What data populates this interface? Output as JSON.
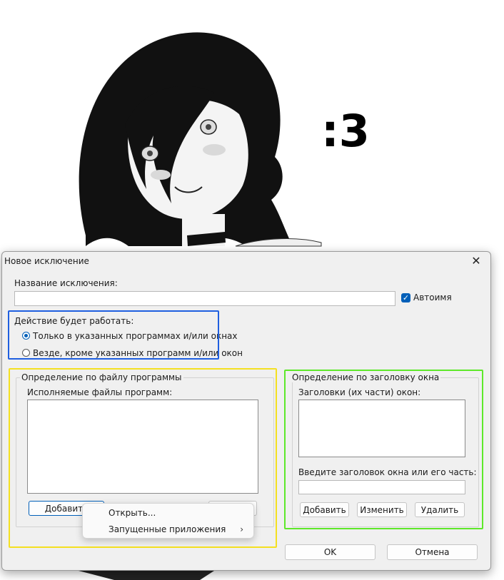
{
  "background": {
    "doodle_text": ":3"
  },
  "dialog": {
    "title": "Новое исключение",
    "close_glyph": "✕",
    "name_label": "Название исключения:",
    "name_value": "",
    "autoname_label": "Автоимя",
    "autoname_checked": true,
    "action_label": "Действие будет работать:",
    "radio_only_label": "Только в указанных программах и/или окнах",
    "radio_except_label": "Везде, кроме указанных программ и/или окон",
    "radio_selected": "only",
    "file_group": {
      "title": "Определение по файлу программы",
      "list_label": "Исполняемые файлы программ:",
      "add_label": "Добавить"
    },
    "window_group": {
      "title": "Определение по заголовку окна",
      "list_label": "Заголовки (их части) окон:",
      "enter_label": "Введите заголовок окна или его часть:",
      "enter_value": "",
      "add_label": "Добавить",
      "edit_label": "Изменить",
      "delete_label": "Удалить"
    },
    "ok_label": "OK",
    "cancel_label": "Отмена"
  },
  "context_menu": {
    "items": [
      {
        "label": "Открыть...",
        "submenu": false
      },
      {
        "label": "Запущенные приложения",
        "submenu": true
      }
    ],
    "submenu_glyph": "›"
  },
  "colors": {
    "accent": "#005fb8",
    "highlight_blue": "#1f5fe0",
    "highlight_yellow": "#f4e021",
    "highlight_green": "#5ee82a"
  }
}
